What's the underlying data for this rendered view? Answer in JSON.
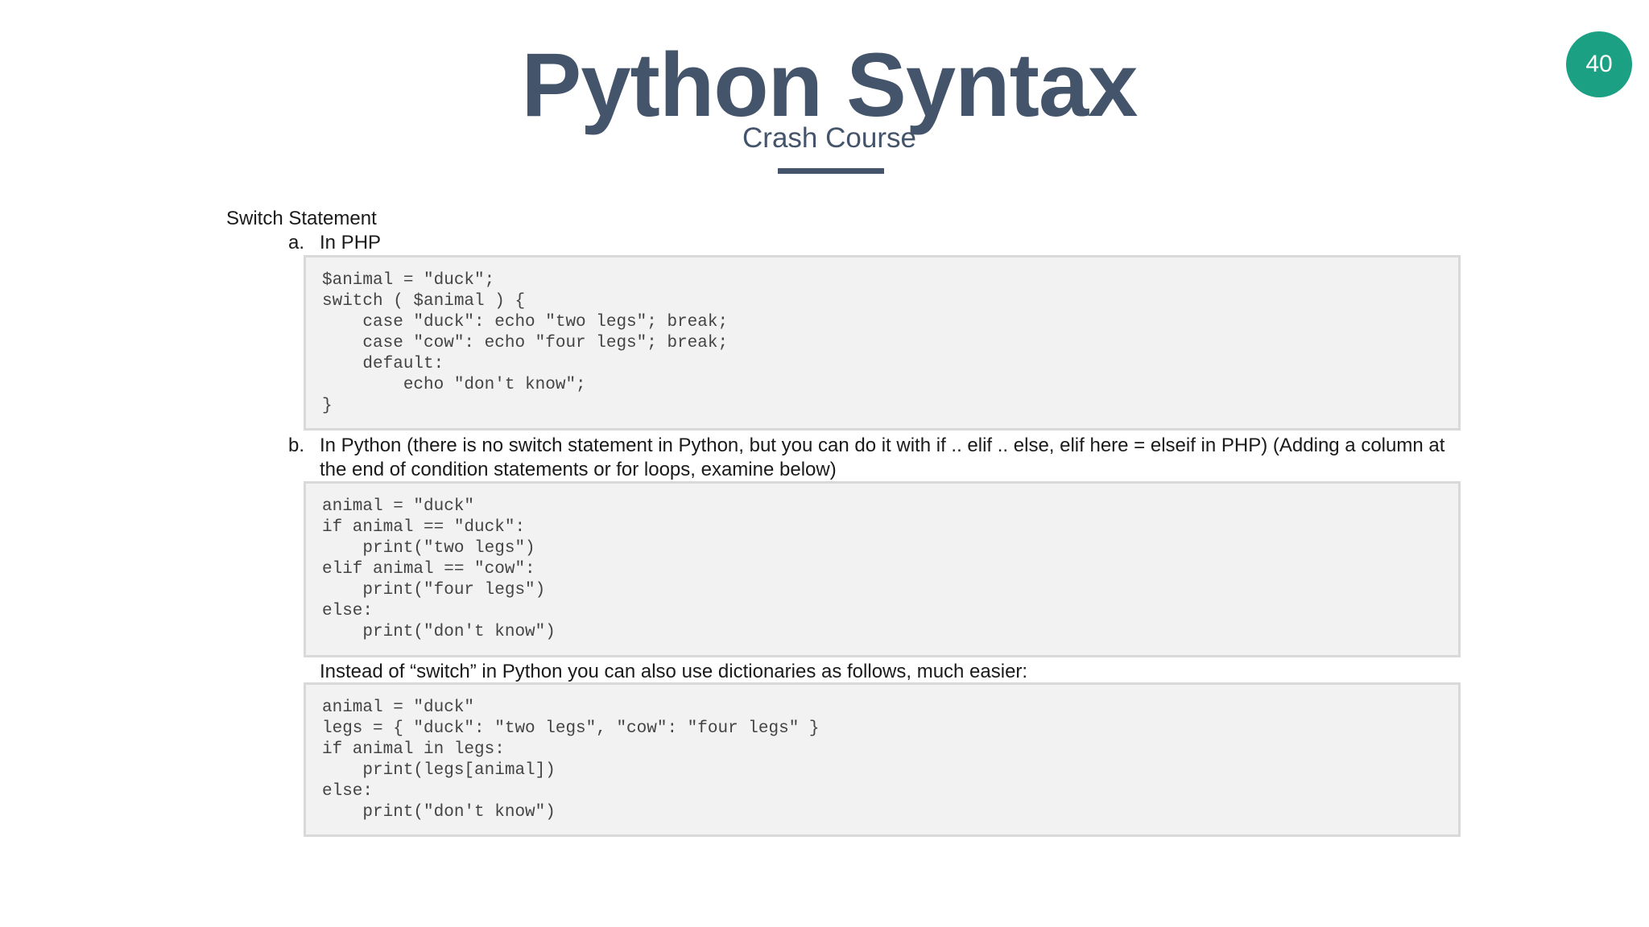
{
  "slide": {
    "title": "Python Syntax",
    "subtitle": "Crash Course",
    "page_number": "40"
  },
  "content": {
    "heading": "Switch Statement",
    "item_a": {
      "marker": "a.",
      "label": "In PHP"
    },
    "php_code": "$animal = \"duck\";\nswitch ( $animal ) {\n    case \"duck\": echo \"two legs\"; break;\n    case \"cow\": echo \"four legs\"; break;\n    default:\n        echo \"don't know\";\n}",
    "item_b": {
      "marker": "b.",
      "line1": "In Python (there is no switch statement in Python, but you can do it with if .. elif .. else, elif here = elseif in PHP) (Adding a column at",
      "line2": "the end of condition statements or for loops, examine below)"
    },
    "python_if_code": "animal = \"duck\"\nif animal == \"duck\":\n    print(\"two legs\")\nelif animal == \"cow\":\n    print(\"four legs\")\nelse:\n    print(\"don't know\")",
    "dict_note": "Instead of “switch” in Python you can also use dictionaries as follows, much easier:",
    "python_dict_code": "animal = \"duck\"\nlegs = { \"duck\": \"two legs\", \"cow\": \"four legs\" }\nif animal in legs:\n    print(legs[animal])\nelse:\n    print(\"don't know\")"
  },
  "colors": {
    "title": "#44546a",
    "badge": "#1ba084",
    "code_background": "#f2f2f2",
    "code_border": "#d9d9d9"
  }
}
